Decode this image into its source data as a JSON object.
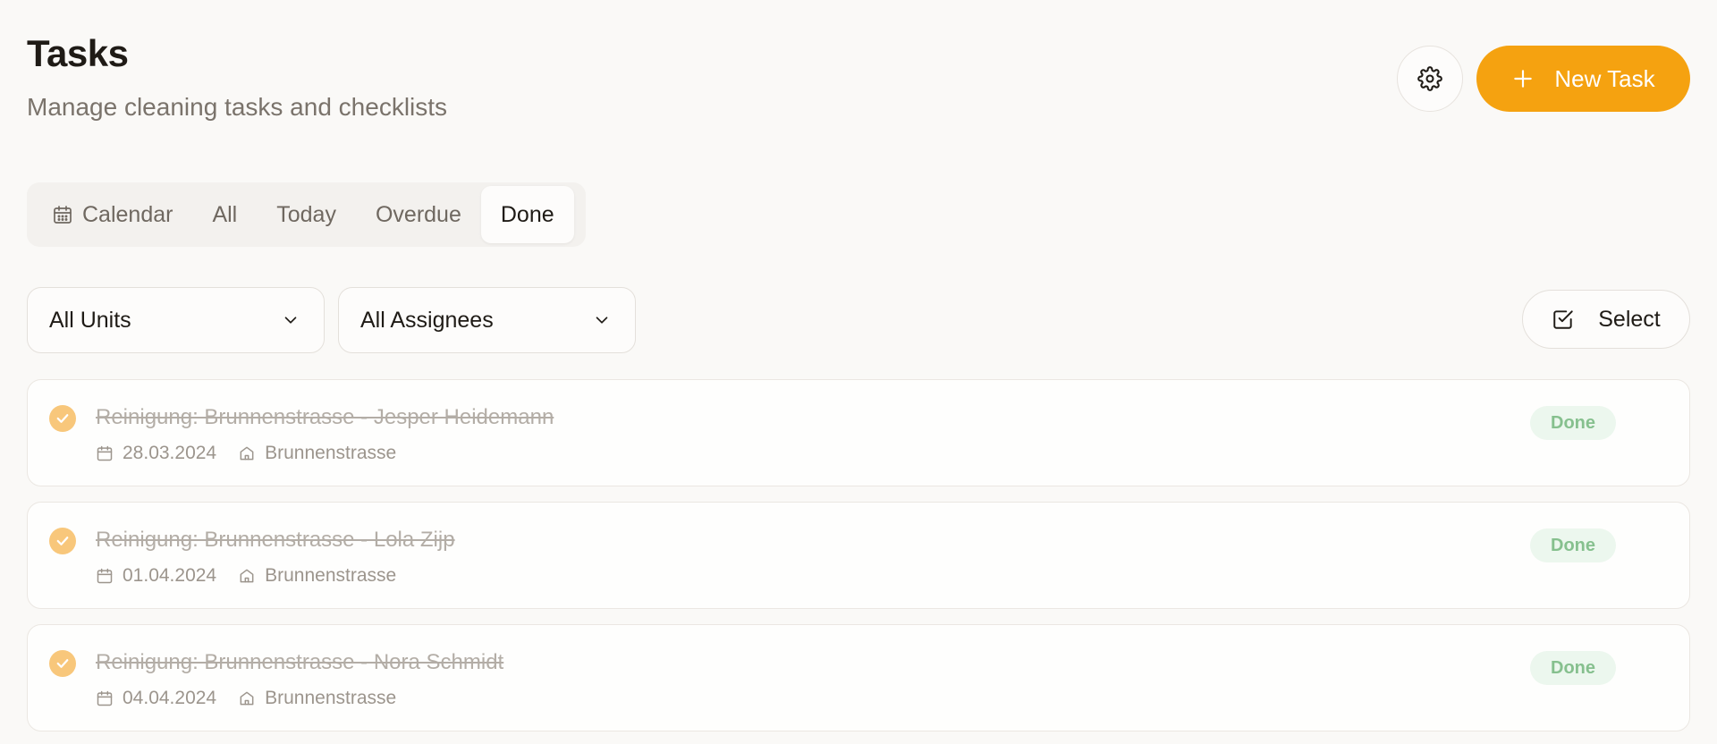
{
  "header": {
    "title": "Tasks",
    "subtitle": "Manage cleaning tasks and checklists",
    "settings_icon": "gear-icon",
    "new_task_label": "New Task",
    "new_task_icon": "plus-icon"
  },
  "colors": {
    "accent": "#f5a210",
    "done_check": "#f8c77b",
    "done_badge_bg": "#ecf7ee",
    "done_badge_text": "#86c08e",
    "background": "#faf9f7"
  },
  "tabs": [
    {
      "label": "Calendar",
      "icon": "calendar-icon",
      "active": false
    },
    {
      "label": "All",
      "active": false
    },
    {
      "label": "Today",
      "active": false
    },
    {
      "label": "Overdue",
      "active": false
    },
    {
      "label": "Done",
      "active": true
    }
  ],
  "filters": {
    "units": {
      "selected": "All Units",
      "icon": "chevron-down-icon"
    },
    "assignees": {
      "selected": "All Assignees",
      "icon": "chevron-down-icon"
    },
    "select_label": "Select",
    "select_icon": "checkbox-icon"
  },
  "tasks": [
    {
      "title": "Reinigung: Brunnenstrasse - Jesper Heidemann",
      "date": "28.03.2024",
      "unit": "Brunnenstrasse",
      "status": "Done"
    },
    {
      "title": "Reinigung: Brunnenstrasse - Lola Zijp",
      "date": "01.04.2024",
      "unit": "Brunnenstrasse",
      "status": "Done"
    },
    {
      "title": "Reinigung: Brunnenstrasse - Nora Schmidt",
      "date": "04.04.2024",
      "unit": "Brunnenstrasse",
      "status": "Done"
    }
  ]
}
